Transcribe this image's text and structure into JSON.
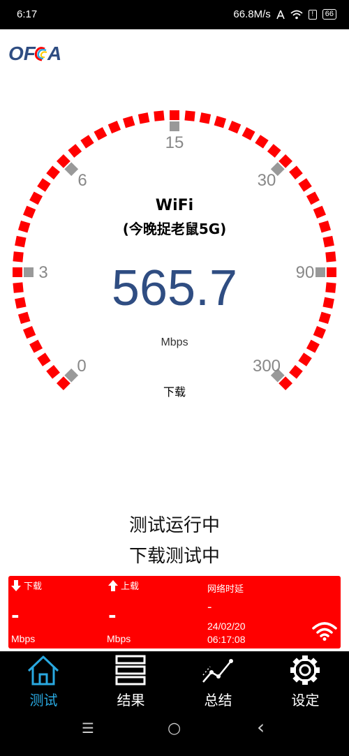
{
  "status_bar": {
    "time": "6:17",
    "net_speed": "66.8M/s",
    "battery": "66",
    "alert": "!"
  },
  "app": {
    "logo_text": "OFCA",
    "brand_colors": [
      "#2f4d82",
      "#ff0000",
      "#2ea8e0",
      "#1a9a3a",
      "#ffcc00"
    ]
  },
  "gauge": {
    "scale_labels": [
      "0",
      "3",
      "6",
      "15",
      "30",
      "90",
      "300"
    ],
    "accent_color": "#ff0000",
    "marker_color": "#999999",
    "network_type": "WiFi",
    "network_name": "(今晚捉老鼠5G)",
    "speed_value": "565.7",
    "speed_unit": "Mbps",
    "direction": "下载"
  },
  "test_status": {
    "line1": "测试运行中",
    "line2": "下载测试中"
  },
  "result_panel": {
    "download_label": "下载",
    "download_value": "-",
    "download_unit": "Mbps",
    "upload_label": "上载",
    "upload_value": "-",
    "upload_unit": "Mbps",
    "latency_label": "网络时延",
    "latency_value": "-",
    "date": "24/02/20",
    "time": "06:17:08",
    "icon": "wifi-icon"
  },
  "bottom_nav": {
    "items": [
      {
        "label": "测试",
        "icon": "home-icon",
        "active": true
      },
      {
        "label": "结果",
        "icon": "list-icon",
        "active": false
      },
      {
        "label": "总结",
        "icon": "line-chart-icon",
        "active": false
      },
      {
        "label": "设定",
        "icon": "gear-icon",
        "active": false
      }
    ],
    "active_color": "#29a8e0"
  },
  "system_nav": {
    "menu_glyph": "☰",
    "home_glyph": "○",
    "back_glyph": "‹"
  }
}
